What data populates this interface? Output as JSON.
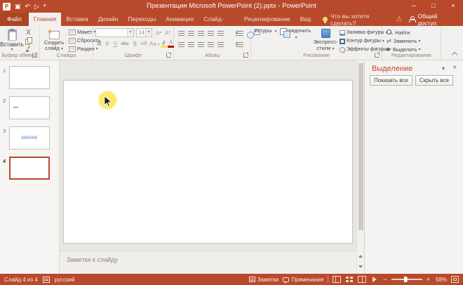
{
  "colors": {
    "accent": "#B84A2B",
    "ribbon_bg": "#F2F0EE",
    "ribbon_border": "#D9D5D1",
    "editor_bg": "#E9E7E4",
    "panel_bg": "#F6F5F3",
    "pane_bg": "#F4F3F1",
    "selection_title": "#BE4B28",
    "disabled_text": "#A39E99",
    "label_text": "#8A8580",
    "slide3_text": "#4472C4"
  },
  "icons": {
    "app": "P",
    "save": "▣",
    "undo": "↶",
    "slideshow": "▷",
    "customize_arrow": "▾",
    "minimize": "─",
    "maximize": "□",
    "close": "×",
    "warning": "⚠",
    "pane_options_arrow": "▾",
    "pane_close": "×",
    "replace": "⇄"
  },
  "title_bar": {
    "title": "Презентация Microsoft PowerPoint (2).pptx - PowerPoint"
  },
  "tab_row": {
    "file_tab": "Файл",
    "tabs": [
      "Главная",
      "Вставка",
      "Дизайн",
      "Переходы",
      "Анимация",
      "Слайд-шоу",
      "Рецензирование",
      "Вид"
    ],
    "active_tab": "Главная",
    "tell_me": "Что вы хотите сделать?",
    "share": "Общий доступ"
  },
  "ribbon": {
    "clipboard": {
      "paste": "Вставить",
      "label": "Буфер обмена"
    },
    "slides": {
      "new_line1": "Создать",
      "new_line2": "слайд",
      "layout": "Макет",
      "reset": "Сбросить",
      "section": "Раздел",
      "label": "Слайды"
    },
    "font": {
      "name_value": "",
      "size_value": "14",
      "grow": "А",
      "shrink": "А",
      "bold": "Ж",
      "italic": "К",
      "underline": "Ч",
      "strike": "abc",
      "shadow": "S",
      "spacing": "АВ",
      "case": "Аа",
      "color": "А",
      "label": "Шрифт"
    },
    "paragraph": {
      "label": "Абзац"
    },
    "drawing": {
      "shapes": "Фигуры",
      "arrange": "Упорядочить",
      "quick_line1": "Экспресс-",
      "quick_line2": "стили",
      "fill": "Заливка фигуры",
      "outline": "Контур фигуры",
      "effects": "Эффекты фигуры",
      "label": "Рисование"
    },
    "editing": {
      "find": "Найти",
      "replace": "Заменить",
      "select": "Выделить",
      "label": "Редактирование"
    }
  },
  "slides_panel": {
    "slides": [
      {
        "number": "1",
        "content": ""
      },
      {
        "number": "2",
        "content": ""
      },
      {
        "number": "3",
        "content": "666666"
      },
      {
        "number": "4",
        "content": ""
      }
    ],
    "active_slide": "4"
  },
  "selection_pane": {
    "title": "Выделение",
    "show_all": "Показать все",
    "hide_all": "Скрыть все"
  },
  "notes": {
    "placeholder": "Заметки к слайду"
  },
  "status_bar": {
    "slide_counter": "Слайд 4 из 4",
    "language": "русский",
    "notes_toggle": "Заметки",
    "comments_toggle": "Примечания",
    "zoom_minus": "−",
    "zoom_plus": "+",
    "zoom_level": "58%"
  }
}
